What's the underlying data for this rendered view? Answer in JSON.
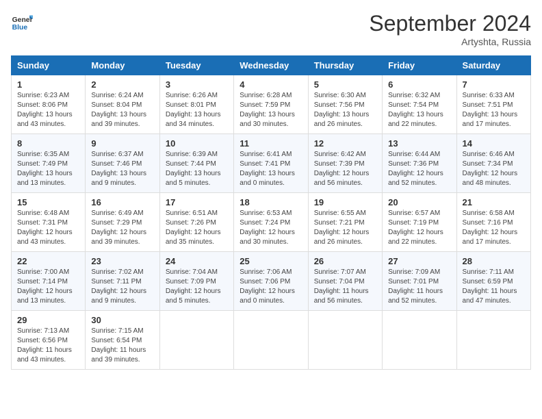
{
  "header": {
    "logo_line1": "General",
    "logo_line2": "Blue",
    "month": "September 2024",
    "location": "Artyshta, Russia"
  },
  "weekdays": [
    "Sunday",
    "Monday",
    "Tuesday",
    "Wednesday",
    "Thursday",
    "Friday",
    "Saturday"
  ],
  "weeks": [
    [
      {
        "day": "1",
        "sunrise": "6:23 AM",
        "sunset": "8:06 PM",
        "daylight": "13 hours and 43 minutes."
      },
      {
        "day": "2",
        "sunrise": "6:24 AM",
        "sunset": "8:04 PM",
        "daylight": "13 hours and 39 minutes."
      },
      {
        "day": "3",
        "sunrise": "6:26 AM",
        "sunset": "8:01 PM",
        "daylight": "13 hours and 34 minutes."
      },
      {
        "day": "4",
        "sunrise": "6:28 AM",
        "sunset": "7:59 PM",
        "daylight": "13 hours and 30 minutes."
      },
      {
        "day": "5",
        "sunrise": "6:30 AM",
        "sunset": "7:56 PM",
        "daylight": "13 hours and 26 minutes."
      },
      {
        "day": "6",
        "sunrise": "6:32 AM",
        "sunset": "7:54 PM",
        "daylight": "13 hours and 22 minutes."
      },
      {
        "day": "7",
        "sunrise": "6:33 AM",
        "sunset": "7:51 PM",
        "daylight": "13 hours and 17 minutes."
      }
    ],
    [
      {
        "day": "8",
        "sunrise": "6:35 AM",
        "sunset": "7:49 PM",
        "daylight": "13 hours and 13 minutes."
      },
      {
        "day": "9",
        "sunrise": "6:37 AM",
        "sunset": "7:46 PM",
        "daylight": "13 hours and 9 minutes."
      },
      {
        "day": "10",
        "sunrise": "6:39 AM",
        "sunset": "7:44 PM",
        "daylight": "13 hours and 5 minutes."
      },
      {
        "day": "11",
        "sunrise": "6:41 AM",
        "sunset": "7:41 PM",
        "daylight": "13 hours and 0 minutes."
      },
      {
        "day": "12",
        "sunrise": "6:42 AM",
        "sunset": "7:39 PM",
        "daylight": "12 hours and 56 minutes."
      },
      {
        "day": "13",
        "sunrise": "6:44 AM",
        "sunset": "7:36 PM",
        "daylight": "12 hours and 52 minutes."
      },
      {
        "day": "14",
        "sunrise": "6:46 AM",
        "sunset": "7:34 PM",
        "daylight": "12 hours and 48 minutes."
      }
    ],
    [
      {
        "day": "15",
        "sunrise": "6:48 AM",
        "sunset": "7:31 PM",
        "daylight": "12 hours and 43 minutes."
      },
      {
        "day": "16",
        "sunrise": "6:49 AM",
        "sunset": "7:29 PM",
        "daylight": "12 hours and 39 minutes."
      },
      {
        "day": "17",
        "sunrise": "6:51 AM",
        "sunset": "7:26 PM",
        "daylight": "12 hours and 35 minutes."
      },
      {
        "day": "18",
        "sunrise": "6:53 AM",
        "sunset": "7:24 PM",
        "daylight": "12 hours and 30 minutes."
      },
      {
        "day": "19",
        "sunrise": "6:55 AM",
        "sunset": "7:21 PM",
        "daylight": "12 hours and 26 minutes."
      },
      {
        "day": "20",
        "sunrise": "6:57 AM",
        "sunset": "7:19 PM",
        "daylight": "12 hours and 22 minutes."
      },
      {
        "day": "21",
        "sunrise": "6:58 AM",
        "sunset": "7:16 PM",
        "daylight": "12 hours and 17 minutes."
      }
    ],
    [
      {
        "day": "22",
        "sunrise": "7:00 AM",
        "sunset": "7:14 PM",
        "daylight": "12 hours and 13 minutes."
      },
      {
        "day": "23",
        "sunrise": "7:02 AM",
        "sunset": "7:11 PM",
        "daylight": "12 hours and 9 minutes."
      },
      {
        "day": "24",
        "sunrise": "7:04 AM",
        "sunset": "7:09 PM",
        "daylight": "12 hours and 5 minutes."
      },
      {
        "day": "25",
        "sunrise": "7:06 AM",
        "sunset": "7:06 PM",
        "daylight": "12 hours and 0 minutes."
      },
      {
        "day": "26",
        "sunrise": "7:07 AM",
        "sunset": "7:04 PM",
        "daylight": "11 hours and 56 minutes."
      },
      {
        "day": "27",
        "sunrise": "7:09 AM",
        "sunset": "7:01 PM",
        "daylight": "11 hours and 52 minutes."
      },
      {
        "day": "28",
        "sunrise": "7:11 AM",
        "sunset": "6:59 PM",
        "daylight": "11 hours and 47 minutes."
      }
    ],
    [
      {
        "day": "29",
        "sunrise": "7:13 AM",
        "sunset": "6:56 PM",
        "daylight": "11 hours and 43 minutes."
      },
      {
        "day": "30",
        "sunrise": "7:15 AM",
        "sunset": "6:54 PM",
        "daylight": "11 hours and 39 minutes."
      },
      null,
      null,
      null,
      null,
      null
    ]
  ]
}
